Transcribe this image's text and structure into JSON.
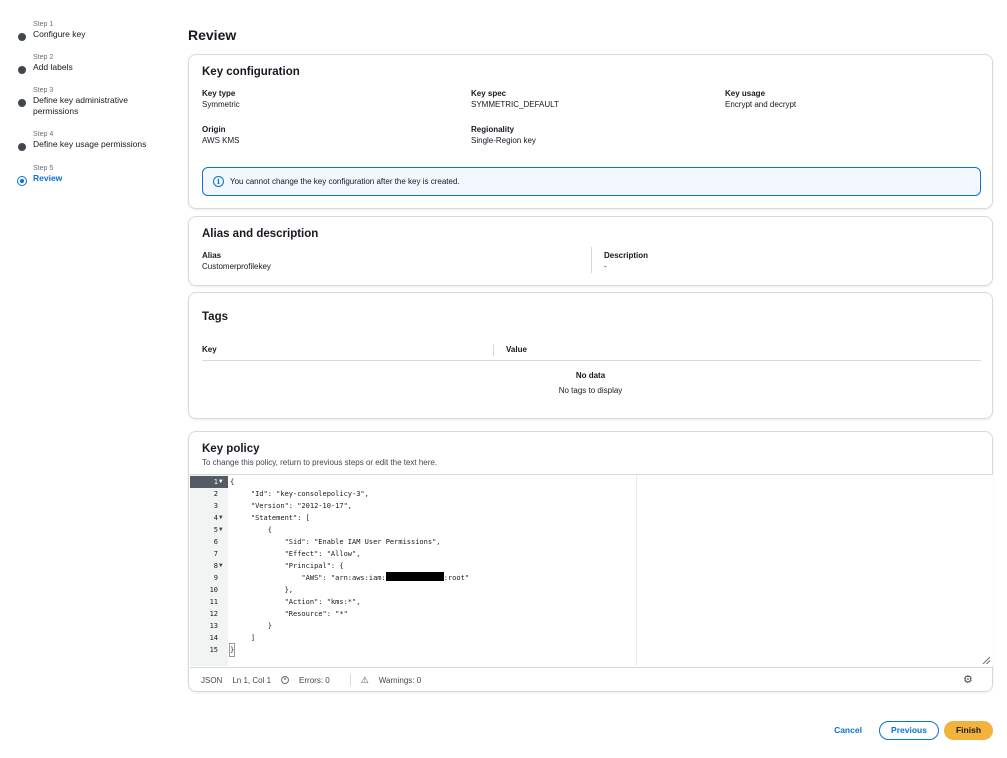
{
  "steps": [
    {
      "num": "Step 1",
      "title": "Configure key"
    },
    {
      "num": "Step 2",
      "title": "Add labels"
    },
    {
      "num": "Step 3",
      "title": "Define key administrative permissions"
    },
    {
      "num": "Step 4",
      "title": "Define key usage permissions"
    },
    {
      "num": "Step 5",
      "title": "Review"
    }
  ],
  "page_title": "Review",
  "key_config": {
    "heading": "Key configuration",
    "key_type_label": "Key type",
    "key_type": "Symmetric",
    "key_spec_label": "Key spec",
    "key_spec": "SYMMETRIC_DEFAULT",
    "key_usage_label": "Key usage",
    "key_usage": "Encrypt and decrypt",
    "origin_label": "Origin",
    "origin": "AWS KMS",
    "regionality_label": "Regionality",
    "regionality": "Single-Region key",
    "alert": "You cannot change the key configuration after the key is created."
  },
  "alias": {
    "heading": "Alias and description",
    "alias_label": "Alias",
    "alias": "Customerprofilekey",
    "description_label": "Description",
    "description": "-"
  },
  "tags": {
    "heading": "Tags",
    "col_key": "Key",
    "col_value": "Value",
    "empty_title": "No data",
    "empty_text": "No tags to display"
  },
  "policy": {
    "heading": "Key policy",
    "subtitle": "To change this policy, return to previous steps or edit the text here.",
    "lines": [
      {
        "n": "1",
        "text": "{"
      },
      {
        "n": "2",
        "text": "    \"Id\": \"key-consolepolicy-3\","
      },
      {
        "n": "3",
        "text": "    \"Version\": \"2012-10-17\","
      },
      {
        "n": "4",
        "text": "    \"Statement\": ["
      },
      {
        "n": "5",
        "text": "        {"
      },
      {
        "n": "6",
        "text": "            \"Sid\": \"Enable IAM User Permissions\","
      },
      {
        "n": "7",
        "text": "            \"Effect\": \"Allow\","
      },
      {
        "n": "8",
        "text": "            \"Principal\": {"
      },
      {
        "n": "9",
        "text_before": "                \"AWS\": \"arn:aws:iam:",
        "text_after": ":root\""
      },
      {
        "n": "10",
        "text": "            },"
      },
      {
        "n": "11",
        "text": "            \"Action\": \"kms:*\","
      },
      {
        "n": "12",
        "text": "            \"Resource\": \"*\""
      },
      {
        "n": "13",
        "text": "        }"
      },
      {
        "n": "14",
        "text": "    ]"
      },
      {
        "n": "15",
        "text": "}"
      }
    ],
    "status_lang": "JSON",
    "status_pos": "Ln 1, Col 1",
    "status_errors": "Errors: 0",
    "status_warnings": "Warnings: 0"
  },
  "footer": {
    "cancel": "Cancel",
    "previous": "Previous",
    "finish": "Finish"
  },
  "colors": {
    "accent": "#0972d3",
    "primary_button": "#f3b13d"
  }
}
